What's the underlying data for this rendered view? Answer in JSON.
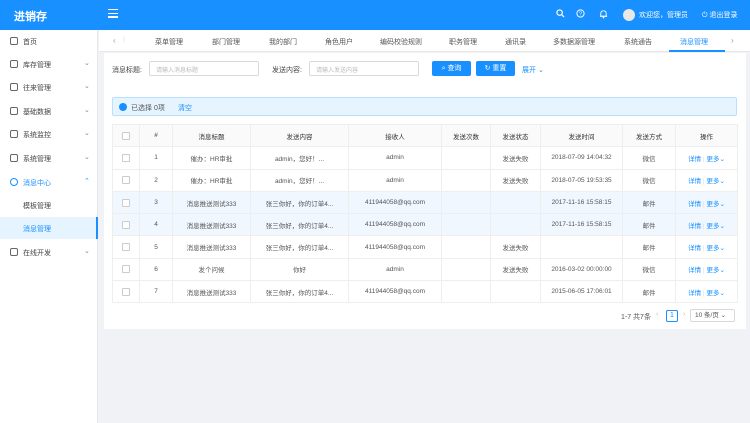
{
  "app": {
    "title": "进销存"
  },
  "header": {
    "user": "欢迎您，管理员",
    "logout": "退出登录",
    "icons": [
      "search-icon",
      "question-icon",
      "bell-icon"
    ]
  },
  "sidebar": {
    "items": [
      {
        "label": "首页",
        "icon": "home-icon",
        "arrow": ""
      },
      {
        "label": "库存管理",
        "icon": "box-icon",
        "arrow": "⌄"
      },
      {
        "label": "往来管理",
        "icon": "contact-icon",
        "arrow": "⌄"
      },
      {
        "label": "基础数据",
        "icon": "table-icon",
        "arrow": "⌄"
      },
      {
        "label": "系统监控",
        "icon": "monitor-icon",
        "arrow": "⌄"
      },
      {
        "label": "系统管理",
        "icon": "gear-icon",
        "arrow": "⌄"
      },
      {
        "label": "消息中心",
        "icon": "message-icon",
        "arrow": "⌃"
      },
      {
        "label": "在线开发",
        "icon": "code-icon",
        "arrow": "⌄"
      }
    ],
    "sub_items": [
      {
        "label": "模板管理"
      },
      {
        "label": "消息管理"
      }
    ]
  },
  "tabs": {
    "items": [
      "菜单管理",
      "部门管理",
      "我的部门",
      "角色用户",
      "编码校验规则",
      "职务管理",
      "通讯录",
      "多数据源管理",
      "系统通告",
      "消息管理"
    ],
    "active": "消息管理"
  },
  "search": {
    "title_label": "消息标题:",
    "title_placeholder": "请输入消息标题",
    "content_label": "发送内容:",
    "content_placeholder": "请输入发送内容",
    "query": "查询",
    "reset": "重置",
    "expand": "展开"
  },
  "alert": {
    "text": "已选择 0项",
    "clear": "清空"
  },
  "table": {
    "headers": [
      "#",
      "消息标题",
      "发送内容",
      "接收人",
      "发送次数",
      "发送状态",
      "发送时间",
      "发送方式",
      "操作"
    ],
    "rows": [
      {
        "num": "1",
        "title": "催办：HR审批",
        "content": "admin，您好！...",
        "receiver": "admin",
        "count": "",
        "status": "发送失败",
        "time": "2018-07-09 14:04:32",
        "method": "微信",
        "detail": "详情",
        "more": "更多"
      },
      {
        "num": "2",
        "title": "催办：HR审批",
        "content": "admin，您好！...",
        "receiver": "admin",
        "count": "",
        "status": "发送失败",
        "time": "2018-07-05 19:53:35",
        "method": "微信",
        "detail": "详情",
        "more": "更多"
      },
      {
        "num": "3",
        "title": "消息推送测试333",
        "content": "张三你好，你的订单4...",
        "receiver": "411944058@qq.com",
        "count": "",
        "status": "",
        "time": "2017-11-16 15:58:15",
        "method": "邮件",
        "detail": "详情",
        "more": "更多"
      },
      {
        "num": "4",
        "title": "消息推送测试333",
        "content": "张三你好，你的订单4...",
        "receiver": "411944058@qq.com",
        "count": "",
        "status": "",
        "time": "2017-11-16 15:58:15",
        "method": "邮件",
        "detail": "详情",
        "more": "更多"
      },
      {
        "num": "5",
        "title": "消息推送测试333",
        "content": "张三你好，你的订单4...",
        "receiver": "411944058@qq.com",
        "count": "",
        "status": "发送失败",
        "time": "",
        "method": "邮件",
        "detail": "详情",
        "more": "更多"
      },
      {
        "num": "6",
        "title": "发个问候",
        "content": "你好",
        "receiver": "admin",
        "count": "",
        "status": "发送失败",
        "time": "2016-03-02 00:00:00",
        "method": "微信",
        "detail": "详情",
        "more": "更多"
      },
      {
        "num": "7",
        "title": "消息推送测试333",
        "content": "张三你好，你的订单4...",
        "receiver": "411944058@qq.com",
        "count": "",
        "status": "",
        "time": "2015-06-05 17:06:01",
        "method": "邮件",
        "detail": "详情",
        "more": "更多"
      }
    ]
  },
  "pager": {
    "summary": "1-7 共7条",
    "current": "1",
    "size": "10 条/页"
  }
}
